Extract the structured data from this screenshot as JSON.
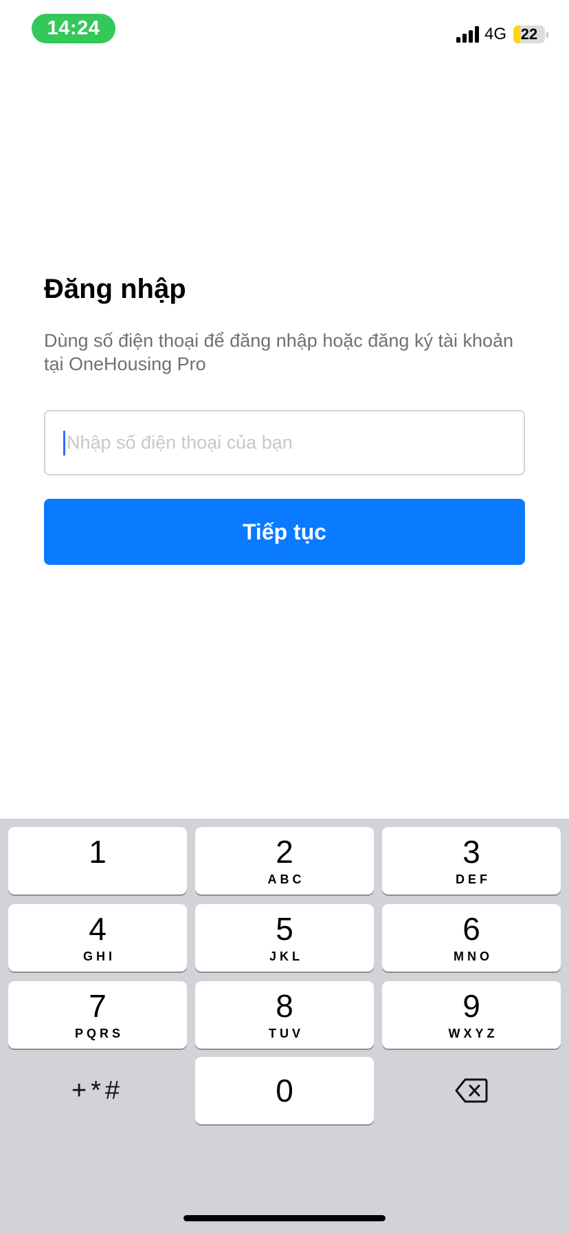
{
  "status_bar": {
    "time": "14:24",
    "network": "4G",
    "battery_level": "22",
    "battery_fraction": 0.22,
    "time_pill_color": "#34c759",
    "battery_color": "#ffd60a"
  },
  "login": {
    "title": "Đăng nhập",
    "subtitle": "Dùng số điện thoại để đăng nhập hoặc đăng ký tài khoản tại OneHousing Pro",
    "phone_input": {
      "value": "",
      "placeholder": "Nhập số điện thoại của bạn"
    },
    "continue_label": "Tiếp tục",
    "accent_color": "#0a7aff"
  },
  "keypad": {
    "keys": [
      {
        "digit": "1",
        "letters": ""
      },
      {
        "digit": "2",
        "letters": "ABC"
      },
      {
        "digit": "3",
        "letters": "DEF"
      },
      {
        "digit": "4",
        "letters": "GHI"
      },
      {
        "digit": "5",
        "letters": "JKL"
      },
      {
        "digit": "6",
        "letters": "MNO"
      },
      {
        "digit": "7",
        "letters": "PQRS"
      },
      {
        "digit": "8",
        "letters": "TUV"
      },
      {
        "digit": "9",
        "letters": "WXYZ"
      },
      {
        "digit": "0",
        "letters": ""
      }
    ],
    "symbols_label": "+*#",
    "delete_icon": "backspace-icon"
  }
}
